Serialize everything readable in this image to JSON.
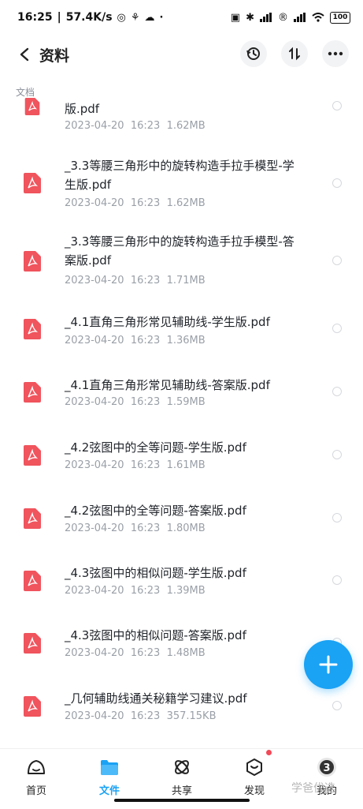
{
  "status_bar": {
    "time": "16:25",
    "speed": "57.4K/s",
    "battery": "100"
  },
  "header": {
    "title": "资料"
  },
  "section": {
    "label": "文档"
  },
  "files": [
    {
      "name": "版.pdf",
      "date": "2023-04-20",
      "time": "16:23",
      "size": "1.62MB"
    },
    {
      "name": "_3.3等腰三角形中的旋转构造手拉手模型-学生版.pdf",
      "date": "2023-04-20",
      "time": "16:23",
      "size": "1.62MB"
    },
    {
      "name": "_3.3等腰三角形中的旋转构造手拉手模型-答案版.pdf",
      "date": "2023-04-20",
      "time": "16:23",
      "size": "1.71MB"
    },
    {
      "name": "_4.1直角三角形常见辅助线-学生版.pdf",
      "date": "2023-04-20",
      "time": "16:23",
      "size": "1.36MB"
    },
    {
      "name": "_4.1直角三角形常见辅助线-答案版.pdf",
      "date": "2023-04-20",
      "time": "16:23",
      "size": "1.59MB"
    },
    {
      "name": "_4.2弦图中的全等问题-学生版.pdf",
      "date": "2023-04-20",
      "time": "16:23",
      "size": "1.61MB"
    },
    {
      "name": "_4.2弦图中的全等问题-答案版.pdf",
      "date": "2023-04-20",
      "time": "16:23",
      "size": "1.80MB"
    },
    {
      "name": "_4.3弦图中的相似问题-学生版.pdf",
      "date": "2023-04-20",
      "time": "16:23",
      "size": "1.39MB"
    },
    {
      "name": "_4.3弦图中的相似问题-答案版.pdf",
      "date": "2023-04-20",
      "time": "16:23",
      "size": "1.48MB"
    },
    {
      "name": "_几何辅助线通关秘籍学习建议.pdf",
      "date": "2023-04-20",
      "time": "16:23",
      "size": "357.15KB"
    }
  ],
  "bottom_nav": {
    "items": [
      {
        "label": "首页",
        "icon": "home-icon"
      },
      {
        "label": "文件",
        "icon": "folder-icon"
      },
      {
        "label": "共享",
        "icon": "share-icon"
      },
      {
        "label": "发现",
        "icon": "discover-icon"
      },
      {
        "label": "我的",
        "icon": "profile-icon"
      }
    ]
  },
  "watermark": "学爸优选",
  "colors": {
    "accent": "#1aa2f5",
    "pdf_red": "#f0545d",
    "notification": "#f24957"
  }
}
